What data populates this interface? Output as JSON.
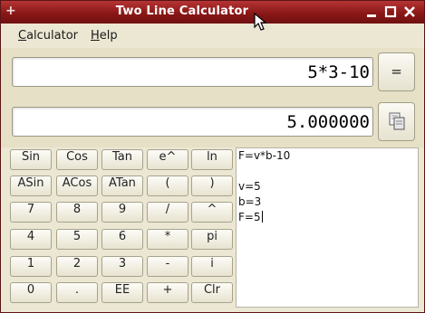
{
  "window": {
    "title": "Two Line Calculator"
  },
  "window_controls": {
    "app_icon": "+",
    "minimize": "–",
    "maximize": "□",
    "close": "✕"
  },
  "menu": {
    "items": [
      {
        "label": "Calculator"
      },
      {
        "label": "Help"
      }
    ]
  },
  "displays": {
    "input": "5*3-10",
    "result": "5.000000"
  },
  "buttons": {
    "equals": "=",
    "copy_icon": "copy-icon"
  },
  "keypad": {
    "rows": [
      [
        "Sin",
        "Cos",
        "Tan",
        "e^",
        "ln"
      ],
      [
        "ASin",
        "ACos",
        "ATan",
        "(",
        ")"
      ],
      [
        "7",
        "8",
        "9",
        "/",
        "^"
      ],
      [
        "4",
        "5",
        "6",
        "*",
        "pi"
      ],
      [
        "1",
        "2",
        "3",
        "-",
        "i"
      ],
      [
        "0",
        ".",
        "EE",
        "+",
        "Clr"
      ]
    ]
  },
  "notes": {
    "lines": [
      "F=v*b-10",
      "",
      "v=5",
      "b=3",
      "F=5"
    ]
  },
  "colors": {
    "titlebar": "#8a1717",
    "background": "#ebe7d3"
  }
}
